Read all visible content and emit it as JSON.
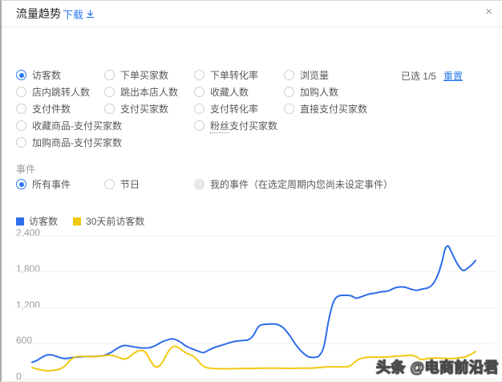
{
  "panel": {
    "title": "流量趋势",
    "download_label": "下载",
    "close_icon": "×"
  },
  "metrics": {
    "selected_info": "已选 1/5",
    "reset_label": "重置",
    "options": [
      {
        "label": "访客数",
        "col": 0,
        "row": 0,
        "state": "selected"
      },
      {
        "label": "下单买家数",
        "col": 1,
        "row": 0
      },
      {
        "label": "下单转化率",
        "col": 2,
        "row": 0
      },
      {
        "label": "浏览量",
        "col": 3,
        "row": 0
      },
      {
        "label": "店内跳转人数",
        "col": 0,
        "row": 1
      },
      {
        "label": "跳出本店人数",
        "col": 1,
        "row": 1
      },
      {
        "label": "收藏人数",
        "col": 2,
        "row": 1
      },
      {
        "label": "加购人数",
        "col": 3,
        "row": 1
      },
      {
        "label": "支付件数",
        "col": 0,
        "row": 2
      },
      {
        "label": "支付买家数",
        "col": 1,
        "row": 2
      },
      {
        "label": "支付转化率",
        "col": 2,
        "row": 2
      },
      {
        "label": "直接支付买家数",
        "col": 3,
        "row": 2
      },
      {
        "label": "收藏商品-支付买家数",
        "col": 0,
        "row": 3
      },
      {
        "label": "粉丝支付买家数",
        "col": 2,
        "row": 3,
        "underline_prefix": "粉丝"
      },
      {
        "label": "加购商品-支付买家数",
        "col": 0,
        "row": 4
      }
    ]
  },
  "events": {
    "section_label": "事件",
    "options": [
      {
        "label": "所有事件",
        "col": 0,
        "state": "selected"
      },
      {
        "label": "节日",
        "col": 1
      },
      {
        "label": "我的事件（在选定周期内您尚未设定事件）",
        "col": 2,
        "state": "disabled"
      }
    ]
  },
  "chart_data": {
    "type": "line",
    "title": "流量趋势",
    "xlabel": "",
    "ylabel": "",
    "ylim": [
      0,
      2400
    ],
    "grid": true,
    "legend_position": "top-left",
    "y_ticks": [
      {
        "label": "2,400",
        "value": 2400
      },
      {
        "label": "1,800",
        "value": 1800
      },
      {
        "label": "1,200",
        "value": 1200
      },
      {
        "label": "600",
        "value": 600
      },
      {
        "label": "0",
        "value": 0
      }
    ],
    "series": [
      {
        "name": "访客数",
        "color": "#2d6cea",
        "points": [
          [
            38,
            290
          ],
          [
            44,
            320
          ],
          [
            50,
            370
          ],
          [
            56,
            408
          ],
          [
            62,
            412
          ],
          [
            68,
            390
          ],
          [
            74,
            362
          ],
          [
            80,
            352
          ],
          [
            88,
            368
          ],
          [
            96,
            380
          ],
          [
            104,
            385
          ],
          [
            112,
            386
          ],
          [
            120,
            390
          ],
          [
            128,
            405
          ],
          [
            136,
            450
          ],
          [
            144,
            520
          ],
          [
            152,
            568
          ],
          [
            160,
            558
          ],
          [
            168,
            540
          ],
          [
            176,
            528
          ],
          [
            184,
            532
          ],
          [
            192,
            570
          ],
          [
            200,
            630
          ],
          [
            208,
            668
          ],
          [
            214,
            680
          ],
          [
            222,
            635
          ],
          [
            230,
            560
          ],
          [
            238,
            512
          ],
          [
            246,
            470
          ],
          [
            252,
            452
          ],
          [
            260,
            505
          ],
          [
            268,
            548
          ],
          [
            276,
            580
          ],
          [
            284,
            615
          ],
          [
            292,
            640
          ],
          [
            300,
            652
          ],
          [
            308,
            668
          ],
          [
            314,
            740
          ],
          [
            320,
            880
          ],
          [
            326,
            920
          ],
          [
            334,
            928
          ],
          [
            342,
            926
          ],
          [
            350,
            880
          ],
          [
            358,
            760
          ],
          [
            366,
            600
          ],
          [
            374,
            470
          ],
          [
            382,
            385
          ],
          [
            390,
            372
          ],
          [
            396,
            400
          ],
          [
            402,
            560
          ],
          [
            408,
            1000
          ],
          [
            414,
            1300
          ],
          [
            420,
            1395
          ],
          [
            428,
            1408
          ],
          [
            436,
            1400
          ],
          [
            442,
            1360
          ],
          [
            450,
            1390
          ],
          [
            458,
            1428
          ],
          [
            466,
            1445
          ],
          [
            474,
            1468
          ],
          [
            482,
            1480
          ],
          [
            490,
            1530
          ],
          [
            497,
            1548
          ],
          [
            504,
            1540
          ],
          [
            511,
            1508
          ],
          [
            518,
            1492
          ],
          [
            525,
            1515
          ],
          [
            532,
            1535
          ],
          [
            538,
            1600
          ],
          [
            544,
            1750
          ],
          [
            549,
            1960
          ],
          [
            553,
            2180
          ],
          [
            557,
            2230
          ],
          [
            561,
            2130
          ],
          [
            566,
            1990
          ],
          [
            571,
            1880
          ],
          [
            576,
            1822
          ],
          [
            581,
            1860
          ],
          [
            586,
            1915
          ],
          [
            591,
            1990
          ]
        ]
      },
      {
        "name": "30天前访客数",
        "color": "#f2c811",
        "points": [
          [
            38,
            200
          ],
          [
            44,
            178
          ],
          [
            50,
            160
          ],
          [
            56,
            150
          ],
          [
            62,
            152
          ],
          [
            68,
            162
          ],
          [
            74,
            185
          ],
          [
            80,
            240
          ],
          [
            86,
            330
          ],
          [
            92,
            378
          ],
          [
            98,
            390
          ],
          [
            104,
            388
          ],
          [
            110,
            382
          ],
          [
            116,
            385
          ],
          [
            122,
            390
          ],
          [
            128,
            398
          ],
          [
            134,
            408
          ],
          [
            140,
            398
          ],
          [
            146,
            372
          ],
          [
            152,
            342
          ],
          [
            158,
            368
          ],
          [
            164,
            430
          ],
          [
            170,
            478
          ],
          [
            175,
            488
          ],
          [
            180,
            445
          ],
          [
            185,
            330
          ],
          [
            190,
            232
          ],
          [
            195,
            215
          ],
          [
            200,
            280
          ],
          [
            205,
            400
          ],
          [
            210,
            510
          ],
          [
            215,
            555
          ],
          [
            220,
            540
          ],
          [
            226,
            480
          ],
          [
            232,
            430
          ],
          [
            238,
            400
          ],
          [
            244,
            330
          ],
          [
            250,
            240
          ],
          [
            256,
            200
          ],
          [
            262,
            188
          ],
          [
            270,
            182
          ],
          [
            280,
            180
          ],
          [
            290,
            183
          ],
          [
            300,
            186
          ],
          [
            312,
            186
          ],
          [
            324,
            190
          ],
          [
            336,
            192
          ],
          [
            348,
            190
          ],
          [
            360,
            188
          ],
          [
            372,
            190
          ],
          [
            384,
            192
          ],
          [
            394,
            200
          ],
          [
            404,
            210
          ],
          [
            414,
            215
          ],
          [
            424,
            212
          ],
          [
            434,
            225
          ],
          [
            444,
            330
          ],
          [
            452,
            365
          ],
          [
            462,
            375
          ],
          [
            472,
            374
          ],
          [
            482,
            380
          ],
          [
            492,
            390
          ],
          [
            502,
            400
          ],
          [
            509,
            405
          ],
          [
            516,
            390
          ],
          [
            523,
            338
          ],
          [
            531,
            350
          ],
          [
            539,
            362
          ],
          [
            547,
            360
          ],
          [
            555,
            353
          ],
          [
            563,
            353
          ],
          [
            571,
            363
          ],
          [
            579,
            383
          ],
          [
            586,
            428
          ],
          [
            591,
            468
          ]
        ]
      }
    ]
  },
  "watermark": "头条 @电商前沿君",
  "colors": {
    "accent_blue": "#2979f2",
    "link_blue": "#2e77f7",
    "line_blue": "#2d6cea",
    "line_yellow": "#f2c811"
  }
}
